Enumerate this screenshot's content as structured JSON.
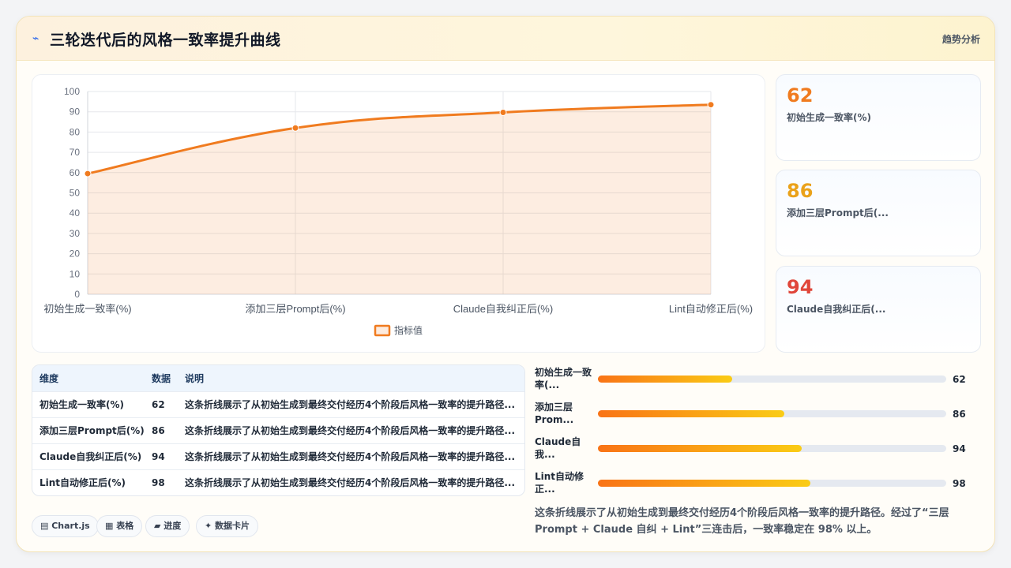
{
  "header": {
    "icon": "trend-icon",
    "title": "三轮迭代后的风格一致率提升曲线",
    "tag": "趋势分析"
  },
  "chart_data": {
    "type": "line",
    "categories": [
      "初始生成一致率(%)",
      "添加三层Prompt后(%)",
      "Claude自我纠正后(%)",
      "Lint自动修正后(%)"
    ],
    "series": [
      {
        "name": "指标值",
        "values": [
          59.5,
          82,
          89.7,
          93.5
        ],
        "color": "#f07b1f"
      }
    ],
    "ylim": [
      0,
      100
    ],
    "yticks": [
      0,
      10,
      20,
      30,
      40,
      50,
      60,
      70,
      80,
      90,
      100
    ],
    "fill": true,
    "legend_position": "bottom",
    "grid": true
  },
  "stats": [
    {
      "value": "62",
      "label": "初始生成一致率(%)",
      "color": "#f07b1f"
    },
    {
      "value": "86",
      "label": "添加三层Prompt后(...",
      "color": "#eaa21a"
    },
    {
      "value": "94",
      "label": "Claude自我纠正后(...",
      "color": "#e0463a"
    }
  ],
  "table": {
    "headers": [
      "维度",
      "数据",
      "说明"
    ],
    "rows": [
      [
        "初始生成一致率(%)",
        "62",
        "这条折线展示了从初始生成到最终交付经历4个阶段后风格一致率的提升路径..."
      ],
      [
        "添加三层Prompt后(%)",
        "86",
        "这条折线展示了从初始生成到最终交付经历4个阶段后风格一致率的提升路径..."
      ],
      [
        "Claude自我纠正后(%)",
        "94",
        "这条折线展示了从初始生成到最终交付经历4个阶段后风格一致率的提升路径..."
      ],
      [
        "Lint自动修正后(%)",
        "98",
        "这条折线展示了从初始生成到最终交付经历4个阶段后风格一致率的提升路径..."
      ]
    ]
  },
  "chips": [
    "▤ Chart.js",
    "▦ 表格",
    "▰ 进度",
    "✦ 数据卡片"
  ],
  "progress": [
    {
      "label_line1": "初始生成一致",
      "label_line2": "率(...",
      "value": 62
    },
    {
      "label_line1": "添加三层",
      "label_line2": "Prom...",
      "value": 86
    },
    {
      "label_line1": "Claude自",
      "label_line2": "我...",
      "value": 94
    },
    {
      "label_line1": "Lint自动修",
      "label_line2": "正...",
      "value": 98
    }
  ],
  "summary": "这条折线展示了从初始生成到最终交付经历4个阶段后风格一致率的提升路径。经过了“三层 Prompt + Claude 自纠 + Lint”三连击后，一致率稳定在 98% 以上。"
}
